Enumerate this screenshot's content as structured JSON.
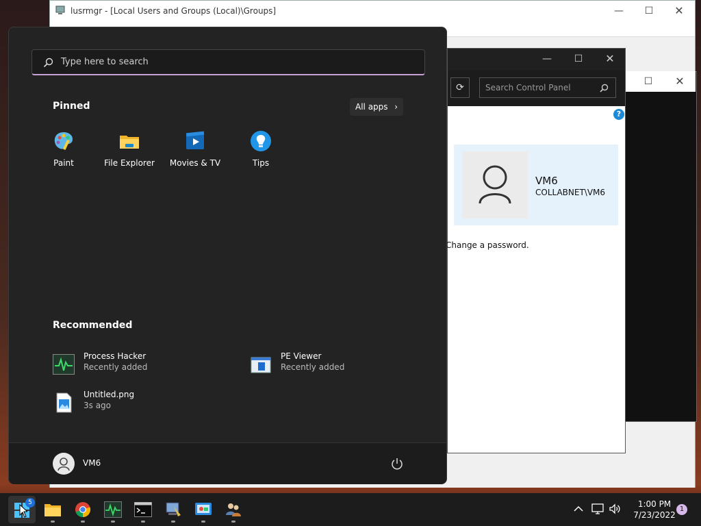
{
  "lusrmgr": {
    "title": "lusrmgr - [Local Users and Groups (Local)\\Groups]"
  },
  "control_panel": {
    "search_placeholder": "Search Control Panel",
    "user_name": "VM6",
    "user_account": "COLLABNET\\VM6",
    "change_password": "Change a password."
  },
  "start_menu": {
    "search_placeholder": "Type here to search",
    "pinned_title": "Pinned",
    "all_apps_label": "All apps",
    "pinned": [
      {
        "label": "Paint",
        "icon": "paint-icon"
      },
      {
        "label": "File Explorer",
        "icon": "folder-icon"
      },
      {
        "label": "Movies & TV",
        "icon": "movies-icon"
      },
      {
        "label": "Tips",
        "icon": "lightbulb-icon"
      }
    ],
    "recommended_title": "Recommended",
    "recommended": [
      {
        "name": "Process Hacker",
        "sub": "Recently added",
        "icon": "process-hacker-icon"
      },
      {
        "name": "PE Viewer",
        "sub": "Recently added",
        "icon": "pe-viewer-icon"
      },
      {
        "name": "Untitled.png",
        "sub": "3s ago",
        "icon": "image-file-icon"
      }
    ],
    "user_name": "VM6"
  },
  "taskbar": {
    "time": "1:00 PM",
    "date": "7/23/2022",
    "notification_count": "1",
    "start_badge": "5"
  },
  "colors": {
    "accent": "#0078d4",
    "search_underline": "#c8a2d6",
    "panel_bg": "#232323"
  }
}
